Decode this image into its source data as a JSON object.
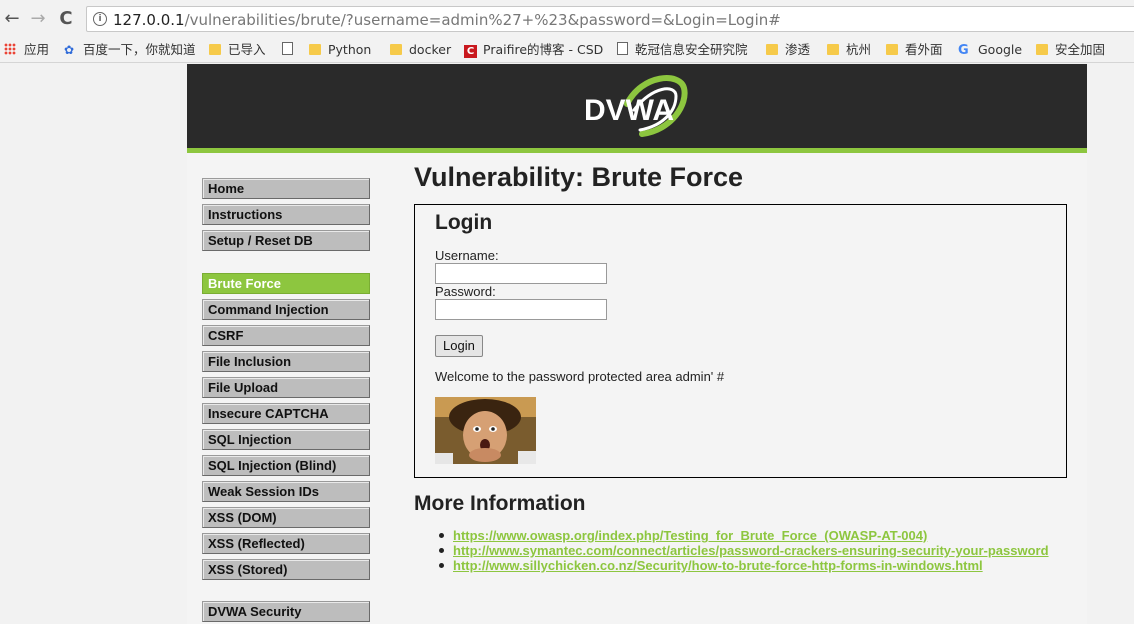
{
  "browser": {
    "url_host": "127.0.0.1",
    "url_path": "/vulnerabilities/brute/?username=admin%27+%23&password=&Login=Login#",
    "back": "←",
    "forward": "→",
    "reload": "C"
  },
  "bookmarks": [
    {
      "label": "应用",
      "icon": "apps-grid-icon"
    },
    {
      "label": "百度一下，你就知道",
      "icon": "baidu-icon"
    },
    {
      "label": "已导入",
      "icon": "folder-icon"
    },
    {
      "label": "",
      "icon": "document-icon"
    },
    {
      "label": "Python",
      "icon": "folder-icon"
    },
    {
      "label": "docker",
      "icon": "folder-icon"
    },
    {
      "label": "Praifire的博客 - CSD",
      "icon": "csdn-icon"
    },
    {
      "label": "乾冠信息安全研究院",
      "icon": "document-icon"
    },
    {
      "label": "渗透",
      "icon": "folder-icon"
    },
    {
      "label": "杭州",
      "icon": "folder-icon"
    },
    {
      "label": "看外面",
      "icon": "folder-icon"
    },
    {
      "label": "Google",
      "icon": "google-icon"
    },
    {
      "label": "安全加固",
      "icon": "folder-icon"
    }
  ],
  "logo_text": "DVWA",
  "menu": [
    {
      "label": "Home"
    },
    {
      "label": "Instructions"
    },
    {
      "label": "Setup / Reset DB"
    },
    {
      "label": "Brute Force",
      "active": true
    },
    {
      "label": "Command Injection"
    },
    {
      "label": "CSRF"
    },
    {
      "label": "File Inclusion"
    },
    {
      "label": "File Upload"
    },
    {
      "label": "Insecure CAPTCHA"
    },
    {
      "label": "SQL Injection"
    },
    {
      "label": "SQL Injection (Blind)"
    },
    {
      "label": "Weak Session IDs"
    },
    {
      "label": "XSS (DOM)"
    },
    {
      "label": "XSS (Reflected)"
    },
    {
      "label": "XSS (Stored)"
    },
    {
      "label": "DVWA Security"
    }
  ],
  "page_title": "Vulnerability: Brute Force",
  "login": {
    "heading": "Login",
    "username_label": "Username:",
    "username_value": "",
    "password_label": "Password:",
    "password_value": "",
    "button": "Login",
    "welcome": "Welcome to the password protected area admin' #"
  },
  "more_info": {
    "heading": "More Information",
    "links": [
      "https://www.owasp.org/index.php/Testing_for_Brute_Force_(OWASP-AT-004)",
      "http://www.symantec.com/connect/articles/password-crackers-ensuring-security-your-password",
      "http://www.sillychicken.co.nz/Security/how-to-brute-force-http-forms-in-windows.html"
    ]
  },
  "colors": {
    "accent": "#8dc63f",
    "header": "#2a2a2a"
  }
}
